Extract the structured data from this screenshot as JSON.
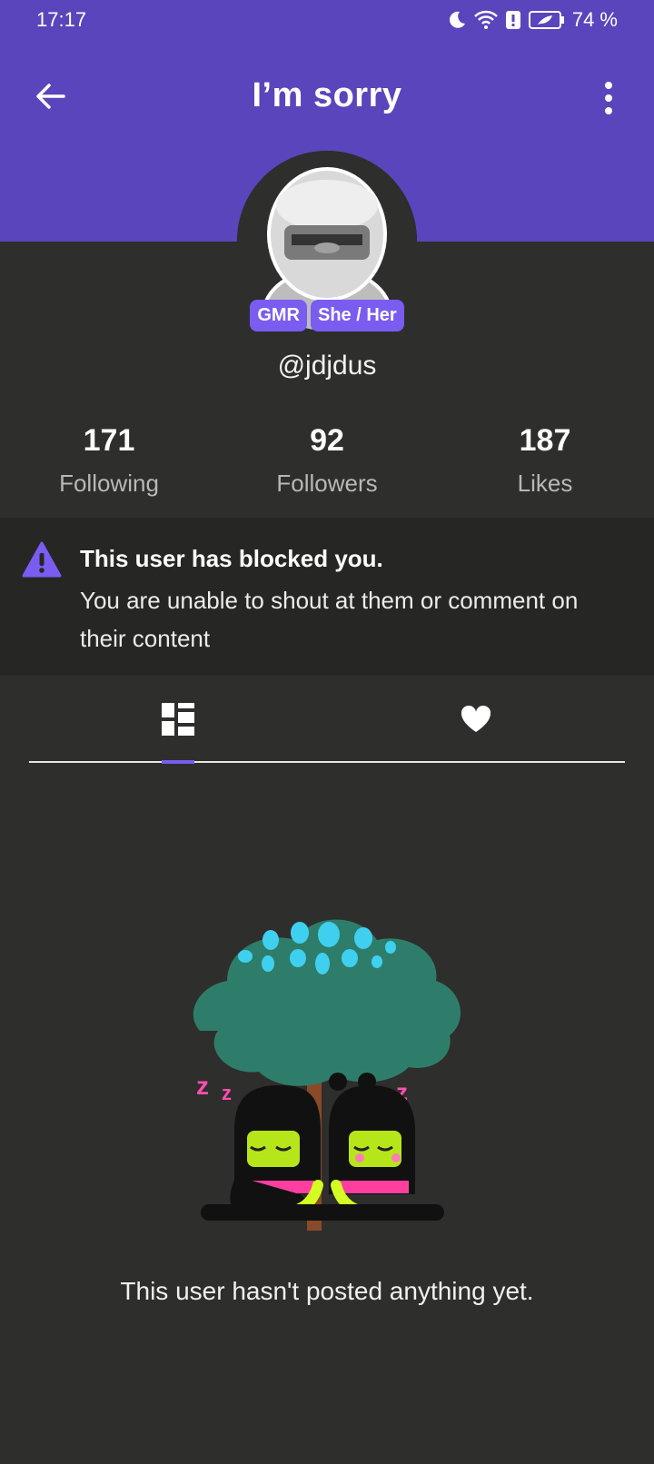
{
  "status_bar": {
    "time": "17:17",
    "battery": "74 %"
  },
  "header": {
    "title": "I’m sorry"
  },
  "profile": {
    "badges": [
      "GMR",
      "She / Her"
    ],
    "username": "@jdjdus"
  },
  "stats": [
    {
      "value": "171",
      "label": "Following"
    },
    {
      "value": "92",
      "label": "Followers"
    },
    {
      "value": "187",
      "label": "Likes"
    }
  ],
  "blocked_notice": {
    "title": "This user has blocked you.",
    "body": "You are unable to shout at them or comment on their content"
  },
  "tabs": [
    {
      "icon": "grid-icon",
      "selected": true
    },
    {
      "icon": "heart-icon",
      "selected": false
    }
  ],
  "empty_state": {
    "message": "This user hasn't posted anything yet."
  },
  "colors": {
    "accent": "#5a45bc",
    "badge": "#7a5cf0",
    "background": "#2e2e2c",
    "notice_bg": "#262624"
  }
}
